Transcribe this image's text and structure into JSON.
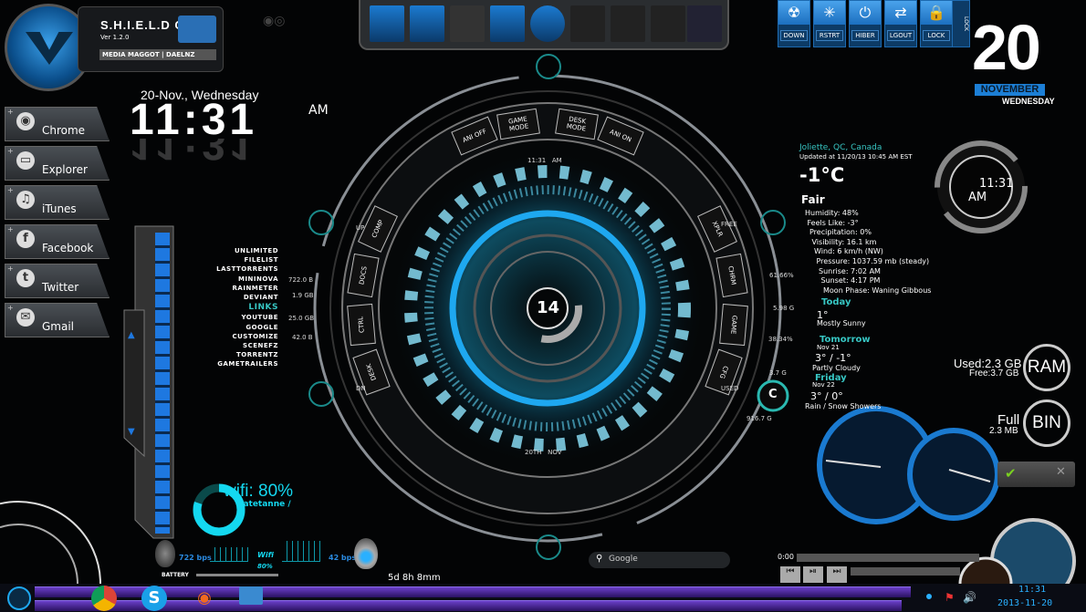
{
  "header": {
    "os_name": "S.H.I.E.L.D OS",
    "version": "Ver 1.2.0",
    "credits": "MEDIA MAGGOT | DAELNZ"
  },
  "clock": {
    "date": "20-Nov., Wednesday",
    "time": "11:31",
    "ampm": "AM"
  },
  "dock": [
    {
      "label": "Chrome",
      "icon": "chrome-icon",
      "glyph": "◉"
    },
    {
      "label": "Explorer",
      "icon": "folder-icon",
      "glyph": "▭"
    },
    {
      "label": "iTunes",
      "icon": "music-icon",
      "glyph": "♫"
    },
    {
      "label": "Facebook",
      "icon": "facebook-icon",
      "glyph": "f"
    },
    {
      "label": "Twitter",
      "icon": "twitter-icon",
      "glyph": "t"
    },
    {
      "label": "Gmail",
      "icon": "mail-icon",
      "glyph": "✉"
    }
  ],
  "power": [
    {
      "label": "DOWN",
      "glyph": "☢"
    },
    {
      "label": "RSTRT",
      "glyph": "✳"
    },
    {
      "label": "HIBER",
      "glyph": "⏻"
    },
    {
      "label": "LGOUT",
      "glyph": "⇄"
    },
    {
      "label": "LOCK",
      "glyph": "🔒"
    }
  ],
  "lock_side": "LOCK",
  "calendar": {
    "day": "20",
    "month": "NOVEMBER",
    "weekday": "WEDNESDAY"
  },
  "analog_clock": {
    "time": "11:31",
    "ampm": "AM"
  },
  "weather": {
    "location": "Joliette, QC, Canada",
    "updated": "Updated at 11/20/13 10:45 AM EST",
    "temp": "-1°C",
    "condition": "Fair",
    "details": [
      "Humidity: 48%",
      "Feels Like: -3°",
      "Precipitation: 0%",
      "Visibility: 16.1 km",
      "Wind: 6 km/h (NW)",
      "Pressure: 1037.59 mb (steady)",
      "Sunrise: 7:02 AM",
      "Sunset:  4:17 PM",
      "Moon Phase: Waning Gibbous"
    ],
    "forecast": [
      {
        "title": "Today",
        "date": "",
        "temp": "1°",
        "cond": "Mostly Sunny"
      },
      {
        "title": "Tomorrow",
        "date": "Nov 21",
        "temp": "3° / -1°",
        "cond": "Partly Cloudy"
      },
      {
        "title": "Friday",
        "date": "Nov 22",
        "temp": "3° / 0°",
        "cond": "Rain / Snow Showers"
      }
    ]
  },
  "links": {
    "items": [
      "UNLIMITED",
      "FILELIST",
      "LASTTORRENTS",
      "MININOVA",
      "RAINMETER",
      "DEVIANT",
      "LINKS",
      "YOUTUBE",
      "GOOGLE",
      "CUSTOMIZE",
      "SCENEFZ",
      "TORRENTZ",
      "GAMETRAILERS"
    ],
    "stats": [
      "722.0 B",
      "1.9 GB",
      "25.0 GB",
      "42.0 B"
    ]
  },
  "hud": {
    "top_buttons": [
      "ANI OFF",
      "GAME MODE",
      "DESK MODE",
      "ANI ON"
    ],
    "left_buttons": [
      "COMP",
      "DOCS",
      "CTRL",
      "DESK"
    ],
    "right_buttons": [
      "XPLR",
      "CHRM",
      "GAME",
      "CFG"
    ],
    "labels": {
      "up": "UP",
      "dn": "DN",
      "free": "FREE",
      "used": "USED",
      "time": "11:31   AM",
      "date": "20TH   NOV"
    },
    "center": "14",
    "disk": {
      "pct1": "61.66%",
      "size": "5.98 G",
      "pct2": "38.34%",
      "free": "3.7 G",
      "drive": "C",
      "total": "916.7 G"
    }
  },
  "memory": {
    "ram_used": "Used:2.3 GB",
    "ram_free": "Free:3.7 GB",
    "ram_label": "RAM",
    "bin_state": "Full",
    "bin_size": "2.3 MB",
    "bin_label": "BIN"
  },
  "wifi": {
    "label": "wifi: 80%",
    "ssid": "patetanne /",
    "percent": 80,
    "down": "722 bps",
    "up": "42 bps",
    "mid_label": "Wifi",
    "mid_pct": "80%",
    "battery": "BATTERY",
    "uptime": "5d 8h 8mm"
  },
  "search": {
    "placeholder": "Google"
  },
  "player": {
    "time": "0:00"
  },
  "taskbar": {
    "time": "11:31",
    "date": "2013-11-20"
  },
  "colors": {
    "accent": "#1ea8f0",
    "teal": "#37c6c3",
    "purple": "#5a2fb0"
  }
}
